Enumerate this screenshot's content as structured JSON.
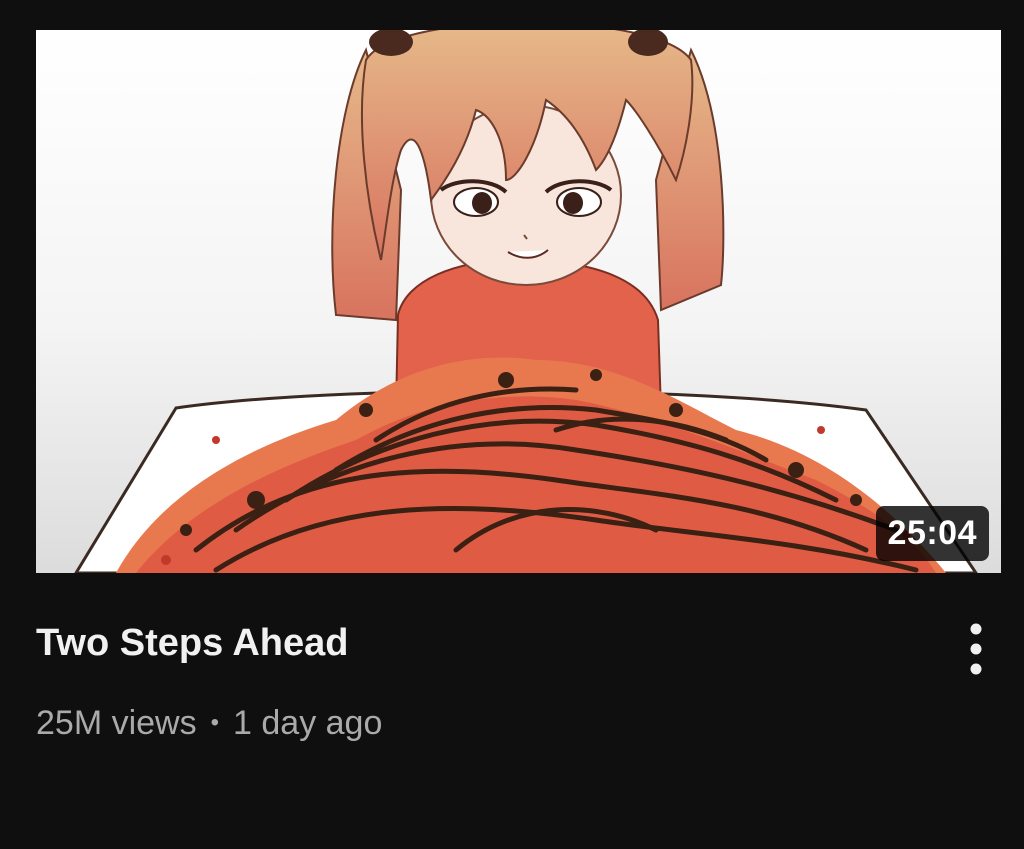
{
  "video": {
    "title": "Two Steps Ahead",
    "duration": "25:04",
    "views": "25M views",
    "separator": "•",
    "uploaded": "1 day ago"
  },
  "icons": {
    "menu": "more-vert-icon"
  },
  "colors": {
    "background": "#0f0f0f",
    "title": "#f1f1f1",
    "meta": "#aaaaaa",
    "duration_badge": "#000000"
  }
}
